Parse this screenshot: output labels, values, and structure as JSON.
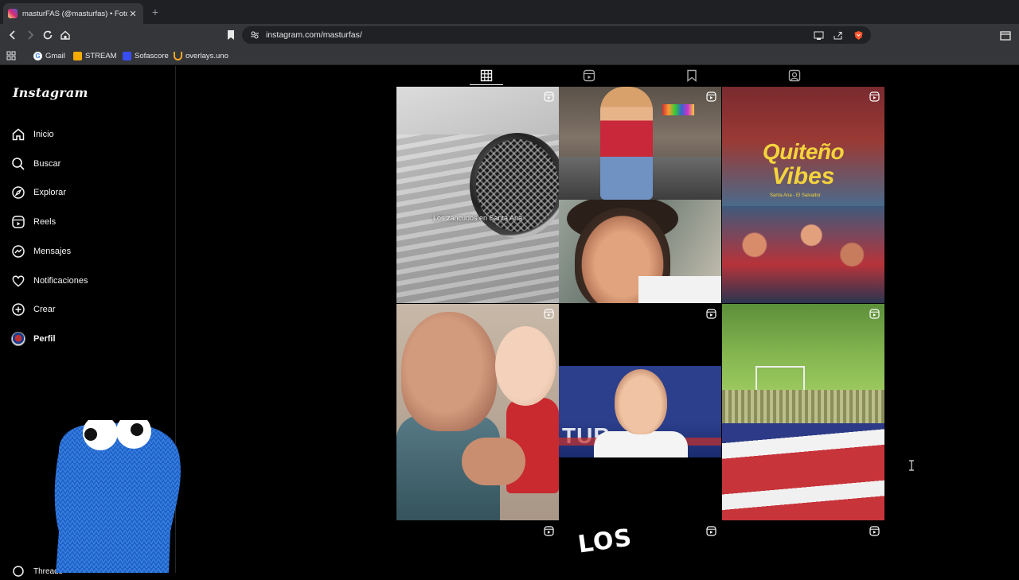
{
  "browser": {
    "tab_title": "masturFAS (@masturfas) • Fotos",
    "url": "instagram.com/masturfas/",
    "bookmarks": [
      {
        "label": "Gmail",
        "color": "#ea4335"
      },
      {
        "label": "STREAM",
        "color": "#f9ab00"
      },
      {
        "label": "Sofascore",
        "color": "#374df5"
      },
      {
        "label": "overlays.uno",
        "color": "#f5a623"
      }
    ]
  },
  "instagram": {
    "logo": "Instagram",
    "nav": [
      {
        "label": "Inicio",
        "icon": "home-icon"
      },
      {
        "label": "Buscar",
        "icon": "search-icon"
      },
      {
        "label": "Explorar",
        "icon": "compass-icon"
      },
      {
        "label": "Reels",
        "icon": "reels-icon"
      },
      {
        "label": "Mensajes",
        "icon": "messenger-icon"
      },
      {
        "label": "Notificaciones",
        "icon": "heart-icon"
      },
      {
        "label": "Crear",
        "icon": "plus-square-icon"
      },
      {
        "label": "Perfil",
        "icon": "avatar"
      }
    ],
    "more_label": "Threads",
    "profile_tabs": [
      "posts-grid-icon",
      "reels-icon",
      "saved-icon",
      "tagged-icon"
    ],
    "posts": [
      {
        "caption": "Los zancudos en Santa Ana"
      },
      {
        "caption": ""
      },
      {
        "caption": ""
      },
      {
        "title_line1": "Quiteño",
        "title_line2": "Vibes",
        "subtitle": "Santa Ana - El Salvador"
      },
      {
        "caption": ""
      },
      {
        "overlay_text": "TUR"
      },
      {
        "caption": ""
      },
      {
        "caption": ""
      },
      {
        "overlay_text": "LOS"
      },
      {
        "caption": ""
      }
    ]
  }
}
